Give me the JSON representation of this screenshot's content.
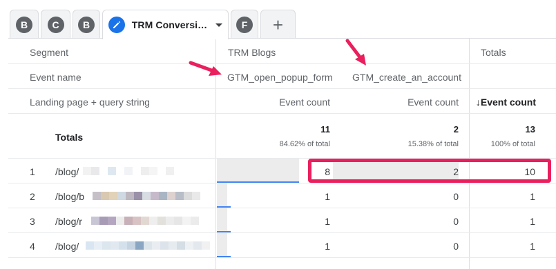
{
  "tabs": [
    {
      "badge": "B"
    },
    {
      "badge": "C"
    },
    {
      "badge": "B"
    },
    {
      "badge": "✎",
      "title": "TRM Conversi…",
      "active": true
    },
    {
      "badge": "F"
    },
    {
      "badge": "+"
    }
  ],
  "table": {
    "header_labels": {
      "segment": "Segment",
      "event_name": "Event name",
      "dimension": "Landing page + query string",
      "segment_value": "TRM Blogs",
      "totals_segment": "Totals",
      "event_1": "GTM_open_popup_form",
      "event_2": "GTM_create_an_account",
      "metric_1": "Event count",
      "metric_2": "Event count",
      "metric_total": "↓Event count"
    },
    "totals": {
      "label": "Totals",
      "col1": "11",
      "col1_sub": "84.62% of total",
      "col2": "2",
      "col2_sub": "15.38% of total",
      "col3": "13",
      "col3_sub": "100% of total"
    },
    "rows": [
      {
        "index": "1",
        "page": "/blog/",
        "col1": "8",
        "col2": "2",
        "col3": "10",
        "bar1": 0.727,
        "bar2": 1.0
      },
      {
        "index": "2",
        "page": "/blog/b",
        "col1": "1",
        "col2": "0",
        "col3": "1",
        "bar1": 0.091,
        "bar2": 0
      },
      {
        "index": "3",
        "page": "/blog/r",
        "col1": "1",
        "col2": "0",
        "col3": "1",
        "bar1": 0.091,
        "bar2": 0
      },
      {
        "index": "4",
        "page": "/blog/",
        "col1": "1",
        "col2": "0",
        "col3": "1",
        "bar1": 0.091,
        "bar2": 0
      }
    ]
  },
  "colors": {
    "accent": "#1a73e8",
    "annotation": "#ea1f5e",
    "bar_fill": "#ececec",
    "bar_baseline": "#4285f4"
  }
}
